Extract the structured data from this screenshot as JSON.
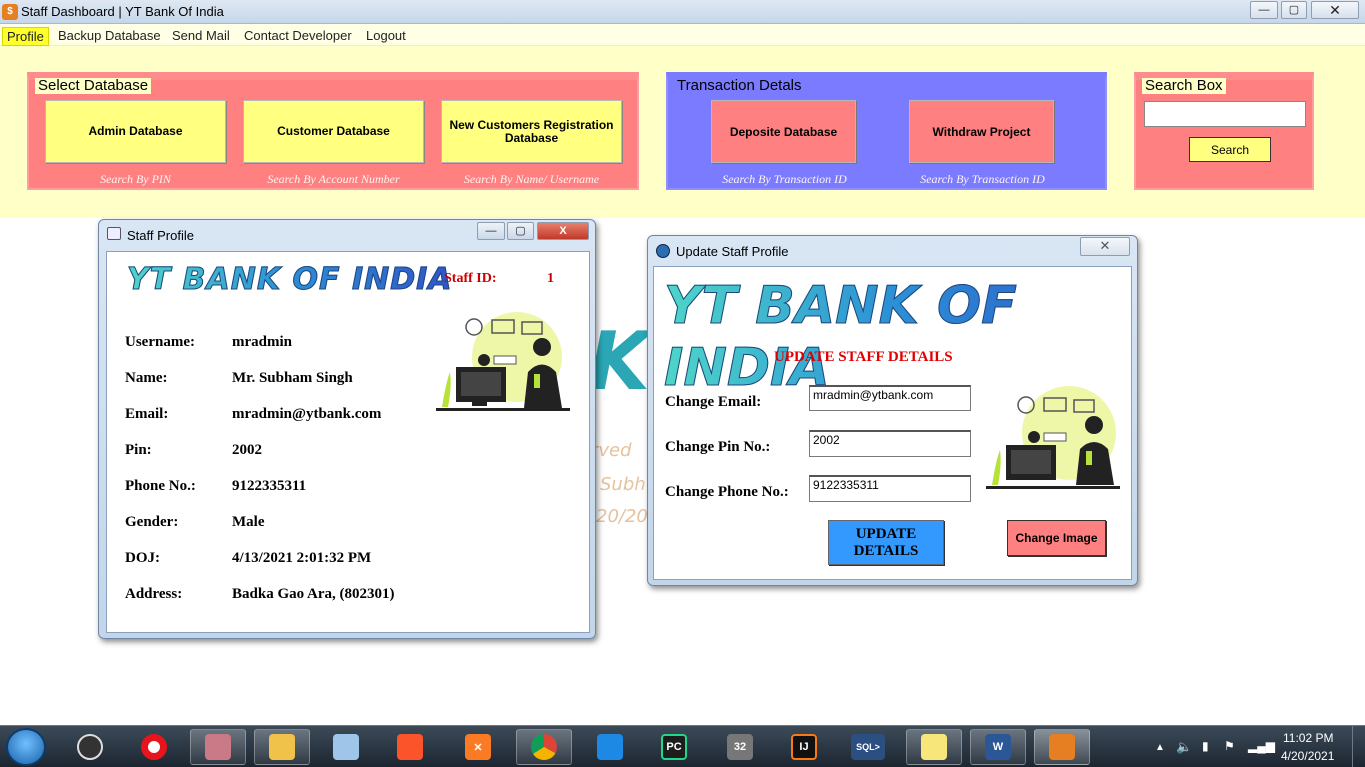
{
  "window": {
    "title": "Staff Dashboard | YT Bank Of India",
    "app_icon": "bank-app-icon",
    "controls": {
      "minimize": "—",
      "maximize": "▢",
      "close": "✕"
    }
  },
  "menu": {
    "items": [
      "Profile",
      "Backup Database",
      "Send Mail",
      "Contact Developer",
      "Logout"
    ]
  },
  "select_database": {
    "title": "Select Database",
    "buttons": [
      {
        "label": "Admin Database",
        "hint": "Search By PIN"
      },
      {
        "label": "Customer Database",
        "hint": "Search By Account Number"
      },
      {
        "label": "New Customers Registration Database",
        "hint": "Search By Name/ Username"
      }
    ]
  },
  "transaction_details": {
    "title": "Transaction Detals",
    "buttons": [
      {
        "label": "Deposite Database",
        "hint": "Search By Transaction ID"
      },
      {
        "label": "Withdraw Project",
        "hint": "Search By Transaction ID"
      }
    ]
  },
  "search_box": {
    "title": "Search Box",
    "input_value": "",
    "button_label": "Search"
  },
  "watermark": {
    "fragment_big": "K",
    "lines": [
      "rved",
      "Subh",
      "20/20"
    ]
  },
  "staff_profile": {
    "title": "Staff Profile",
    "logo_text": "YT BANK OF INDIA",
    "staff_id_label": "Staff ID:",
    "staff_id_value": "1",
    "fields": [
      {
        "label": "Username:",
        "value": "mradmin"
      },
      {
        "label": "Name:",
        "value": "Mr. Subham Singh"
      },
      {
        "label": "Email:",
        "value": "mradmin@ytbank.com"
      },
      {
        "label": "Pin:",
        "value": "2002"
      },
      {
        "label": "Phone No.:",
        "value": "9122335311"
      },
      {
        "label": "Gender:",
        "value": "Male"
      },
      {
        "label": "DOJ:",
        "value": "4/13/2021 2:01:32 PM"
      },
      {
        "label": "Address:",
        "value": "Badka Gao Ara, (802301)"
      }
    ],
    "controls": {
      "minimize": "—",
      "maximize": "▢",
      "close": "X"
    }
  },
  "update_profile": {
    "title": "Update Staff Profile",
    "logo_text": "YT BANK OF INDIA",
    "heading": "UPDATE STAFF DETAILS",
    "fields": [
      {
        "label": "Change Email:",
        "value": "mradmin@ytbank.com"
      },
      {
        "label": "Change Pin No.:",
        "value": "2002"
      },
      {
        "label": "Change Phone No.:",
        "value": "9122335311"
      }
    ],
    "update_button": "UPDATE DETAILS",
    "change_image_button": "Change Image",
    "close": "✕"
  },
  "taskbar": {
    "apps": [
      {
        "name": "start-orb-icon",
        "label": ""
      },
      {
        "name": "obs-icon",
        "label": ""
      },
      {
        "name": "opera-icon",
        "label": ""
      },
      {
        "name": "snipping-tool-icon",
        "label": ""
      },
      {
        "name": "file-explorer-icon",
        "label": ""
      },
      {
        "name": "notepad-icon",
        "label": ""
      },
      {
        "name": "brave-icon",
        "label": ""
      },
      {
        "name": "xampp-icon",
        "label": ""
      },
      {
        "name": "chrome-icon",
        "label": ""
      },
      {
        "name": "vscode-icon",
        "label": ""
      },
      {
        "name": "pycharm-icon",
        "label": "PC"
      },
      {
        "name": "app-32-icon",
        "label": "32"
      },
      {
        "name": "intellij-icon",
        "label": "IJ"
      },
      {
        "name": "sql-icon",
        "label": "SQL>"
      },
      {
        "name": "sticky-notes-icon",
        "label": ""
      },
      {
        "name": "word-icon",
        "label": "W"
      },
      {
        "name": "bank-app-taskbar-icon",
        "label": ""
      }
    ],
    "clock_time": "11:02 PM",
    "clock_date": "4/20/2021"
  },
  "colors": {
    "band": "#ffffc8",
    "pink": "#ff8080",
    "blue": "#7b7bff",
    "yellow_button": "#ffff80",
    "update_button": "#3399ff",
    "heading_red": "#e00000"
  }
}
